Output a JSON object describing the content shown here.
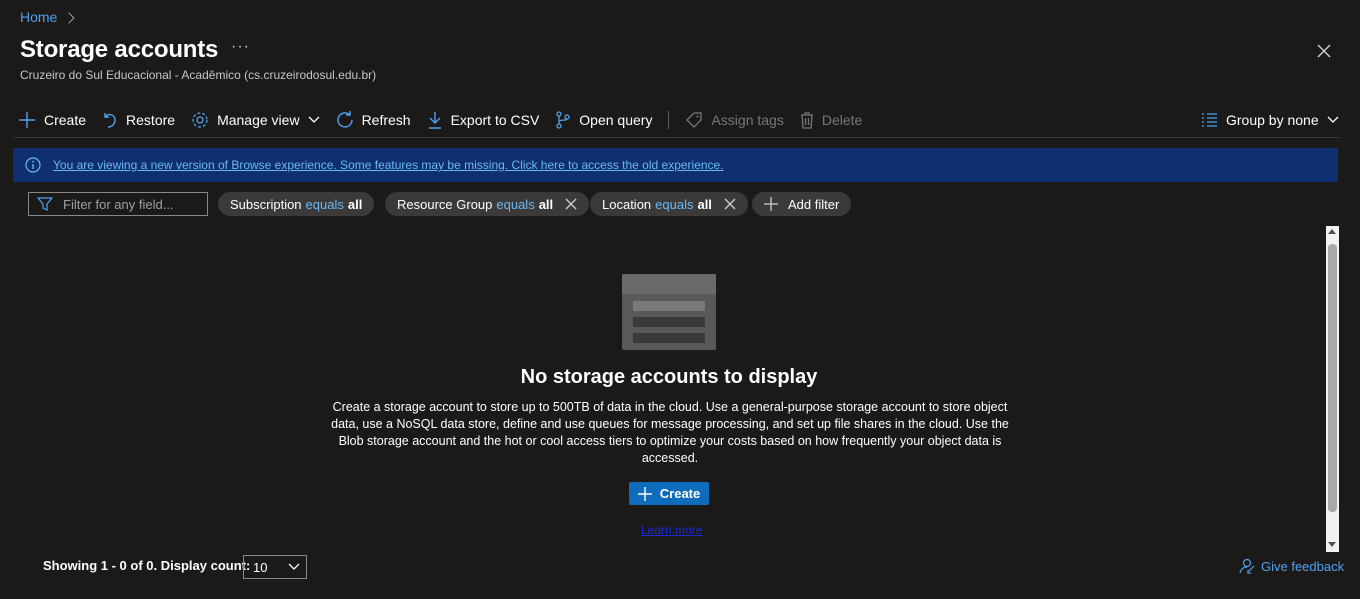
{
  "breadcrumb": {
    "home": "Home"
  },
  "page": {
    "title": "Storage accounts",
    "more": "···",
    "subtitle": "Cruzeiro do Sul Educacional - Acadêmico (cs.cruzeirodosul.edu.br)"
  },
  "toolbar": {
    "create": "Create",
    "restore": "Restore",
    "manage_view": "Manage view",
    "refresh": "Refresh",
    "export_csv": "Export to CSV",
    "open_query": "Open query",
    "assign_tags": "Assign tags",
    "delete": "Delete",
    "group_by": "Group by none"
  },
  "banner": {
    "text": "You are viewing a new version of Browse experience. Some features may be missing. Click here to access the old experience."
  },
  "filters": {
    "placeholder": "Filter for any field...",
    "pills": [
      {
        "field": "Subscription",
        "op": "equals",
        "value": "all"
      },
      {
        "field": "Resource Group",
        "op": "equals",
        "value": "all"
      },
      {
        "field": "Location",
        "op": "equals",
        "value": "all"
      }
    ],
    "add_filter": "Add filter"
  },
  "empty_state": {
    "title": "No storage accounts to display",
    "description": "Create a storage account to store up to 500TB of data in the cloud. Use a general-purpose storage account to store object data, use a NoSQL data store, define and use queues for message processing, and set up file shares in the cloud. Use the Blob storage account and the hot or cool access tiers to optimize your costs based on how frequently your object data is accessed.",
    "create_label": "Create",
    "learn_more": "Learn more"
  },
  "footer": {
    "showing": "Showing 1 - 0 of 0. Display count:",
    "display_count": "10",
    "feedback": "Give feedback"
  },
  "colors": {
    "background": "#1b1a19",
    "accent": "#0f6cbd",
    "link": "#4ea1f3",
    "banner": "#0f2f6e"
  }
}
